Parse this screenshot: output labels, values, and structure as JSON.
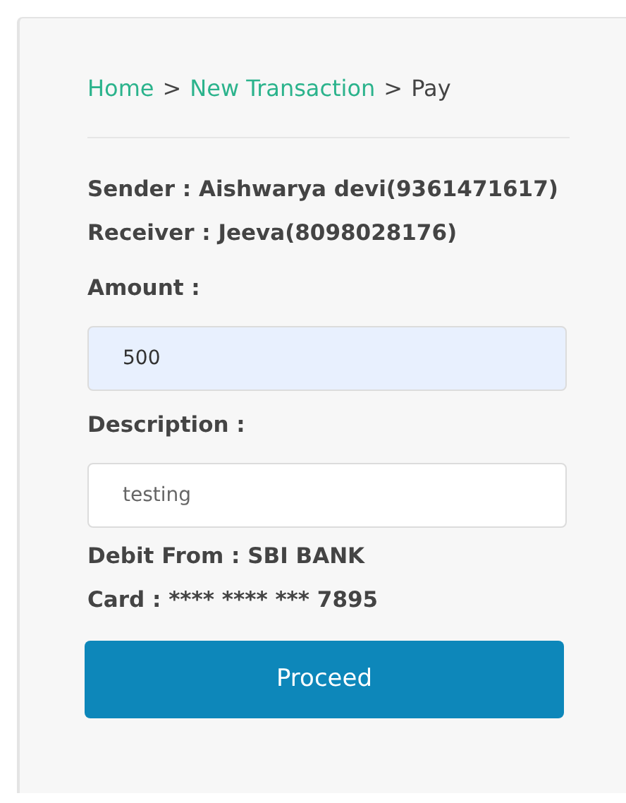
{
  "breadcrumb": {
    "separator": ">",
    "items": [
      {
        "label": "Home",
        "kind": "link"
      },
      {
        "label": "New Transaction",
        "kind": "link"
      },
      {
        "label": "Pay",
        "kind": "current"
      }
    ]
  },
  "details": [
    "Sender : Aishwarya devi(9361471617)",
    "Receiver : Jeeva(8098028176)"
  ],
  "fields": [
    {
      "label": "Amount :",
      "value": "500",
      "autofilled": true
    },
    {
      "label": "Description :",
      "value": "testing",
      "autofilled": false
    }
  ],
  "debit": [
    "Debit From : SBI BANK",
    "Card : **** **** *** 7895"
  ],
  "button": "Proceed"
}
